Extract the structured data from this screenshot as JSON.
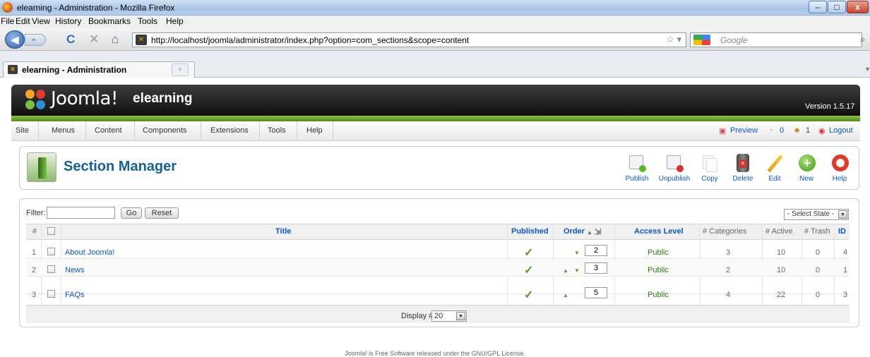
{
  "window": {
    "title": "elearning - Administration - Mozilla Firefox",
    "min": "–",
    "max": "□",
    "close": "x"
  },
  "menubar": {
    "file": "File",
    "edit": "Edit",
    "view": "View",
    "history": "History",
    "bookmarks": "Bookmarks",
    "tools": "Tools",
    "help": "Help"
  },
  "nav": {
    "back": "◀",
    "forward": "▸",
    "reload": "C",
    "stop": "✕",
    "home": "⌂",
    "url": "http://localhost/joomla/administrator/index.php?option=com_sections&scope=content",
    "star": "☆ ▾",
    "search_placeholder": "Google",
    "search_glyph": "⌕"
  },
  "tab": {
    "label": "elearning - Administration",
    "newtab": "+"
  },
  "joomla": {
    "brand": "Joomla!",
    "site": "elearning",
    "version": "Version 1.5.17",
    "logo_colors": [
      "#f4a426",
      "#e03b2e",
      "#7ac143",
      "#2c8ed6"
    ],
    "menu": [
      "Site",
      "Menus",
      "Content",
      "Components",
      "Extensions",
      "Tools",
      "Help"
    ],
    "status": {
      "preview": "Preview",
      "messages": "0",
      "users": "1",
      "logout": "Logout"
    }
  },
  "page": {
    "title": "Section Manager"
  },
  "toolbar": {
    "publish": "Publish",
    "unpublish": "Unpublish",
    "copy": "Copy",
    "delete": "Delete",
    "edit": "Edit",
    "new": "New",
    "help": "Help"
  },
  "filter": {
    "label": "Filter:",
    "value": "",
    "go": "Go",
    "reset": "Reset",
    "state": "- Select State -"
  },
  "table": {
    "headers": {
      "num": "#",
      "title": "Title",
      "published": "Published",
      "order": "Order",
      "access": "Access Level",
      "categories": "# Categories",
      "active": "# Active",
      "trash": "# Trash",
      "id": "ID"
    },
    "rows": [
      {
        "num": "1",
        "title": "About Joomla!",
        "published": "✓",
        "order": "2",
        "access": "Public",
        "categories": "3",
        "active": "10",
        "trash": "0",
        "id": "4"
      },
      {
        "num": "2",
        "title": "News",
        "published": "✓",
        "order": "3",
        "access": "Public",
        "categories": "2",
        "active": "10",
        "trash": "0",
        "id": "1"
      },
      {
        "num": "3",
        "title": "FAQs",
        "published": "✓",
        "order": "5",
        "access": "Public",
        "categories": "4",
        "active": "22",
        "trash": "0",
        "id": "3"
      }
    ],
    "display_label": "Display #",
    "display_value": "20"
  },
  "footer": {
    "text": "Joomla! is Free Software released under the GNU/GPL License."
  }
}
